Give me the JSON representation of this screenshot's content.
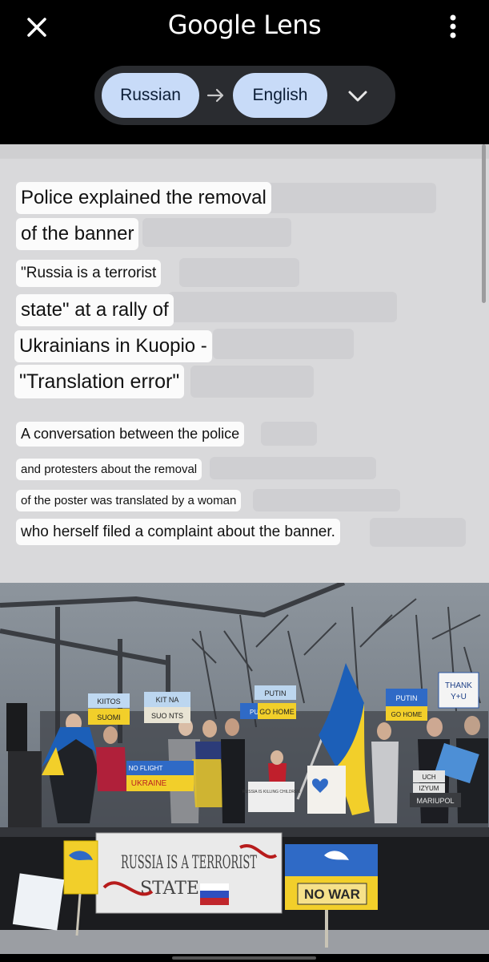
{
  "app": {
    "title": "Google Lens"
  },
  "translate": {
    "source_lang": "Russian",
    "target_lang": "English"
  },
  "article": {
    "headline_lines": [
      "Police explained the removal",
      "of the banner",
      "\"Russia is a terrorist",
      "state\" at a rally of",
      "Ukrainians in Kuopio -",
      "\"Translation error\""
    ],
    "body_lines": [
      "A conversation between the police",
      "and protesters about the removal",
      "of the poster was translated by a woman",
      "who herself filed a complaint about the banner."
    ]
  },
  "photo": {
    "signs": {
      "kiitos": "KIITOS",
      "suomi": "SUOMI",
      "kit_na": "KIT NA",
      "suo_nts": "SUO NTS",
      "putin_go_home_1": "PUTIN",
      "go_home_1": "GO HOME",
      "putin_go_home_2": "PUTIN",
      "go_home_2": "GO HOME",
      "thank": "THANK",
      "thank_2": "Y+U",
      "no_fly": "NO FLIGHT",
      "ukraine": "UKRAINE",
      "russia_killing": "RUSSIA IS KILLING CHILDREN",
      "uch": "UCH",
      "izyum": "IZYUM",
      "mariupol": "MARIUPOL",
      "banner_line1": "RUSSIA IS A TERRORIST",
      "banner_line2": "STATE",
      "no_war": "NO WAR"
    }
  },
  "colors": {
    "pill_bg": "#c8dbf8",
    "topbar_bg": "#000000",
    "article_bg": "#d9d9db",
    "ukraine_blue": "#1c5fb8",
    "ukraine_yellow": "#f2cf2a"
  }
}
